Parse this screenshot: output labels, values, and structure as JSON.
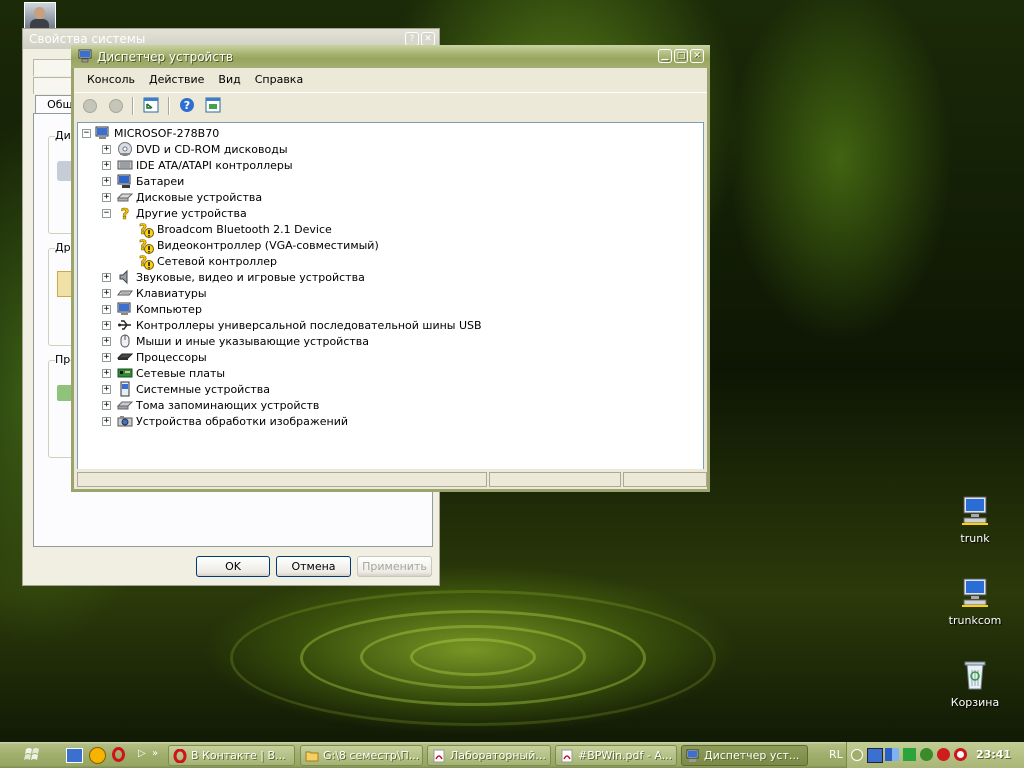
{
  "system_properties": {
    "title": "Свойства системы",
    "tab_general": "Общ",
    "group1_label": "Ди",
    "group2_label": "Др",
    "group3_label": "Пр",
    "ok_label": "OK",
    "cancel_label": "Отмена",
    "apply_label": "Применить"
  },
  "device_manager": {
    "title": "Диспетчер устройств",
    "menu": [
      "Консоль",
      "Действие",
      "Вид",
      "Справка"
    ],
    "root": "MICROSOF-278B70",
    "categories": [
      {
        "label": "DVD и CD-ROM дисководы",
        "icon": "cdrom-icon"
      },
      {
        "label": "IDE ATA/ATAPI контроллеры",
        "icon": "ide-controller-icon"
      },
      {
        "label": "Батареи",
        "icon": "battery-icon"
      },
      {
        "label": "Дисковые устройства",
        "icon": "disk-drive-icon"
      },
      {
        "label": "Другие устройства",
        "icon": "unknown-device-icon",
        "expanded": true,
        "children": [
          {
            "label": "Broadcom Bluetooth 2.1 Device",
            "icon": "warning-device-icon"
          },
          {
            "label": "Видеоконтроллер (VGA-совместимый)",
            "icon": "warning-device-icon"
          },
          {
            "label": "Сетевой контроллер",
            "icon": "warning-device-icon"
          }
        ]
      },
      {
        "label": "Звуковые, видео и игровые устройства",
        "icon": "speaker-icon"
      },
      {
        "label": "Клавиатуры",
        "icon": "keyboard-icon"
      },
      {
        "label": "Компьютер",
        "icon": "computer-icon"
      },
      {
        "label": "Контроллеры универсальной последовательной шины USB",
        "icon": "usb-icon"
      },
      {
        "label": "Мыши и иные указывающие устройства",
        "icon": "mouse-icon"
      },
      {
        "label": "Процессоры",
        "icon": "cpu-icon"
      },
      {
        "label": "Сетевые платы",
        "icon": "network-card-icon"
      },
      {
        "label": "Системные устройства",
        "icon": "system-device-icon"
      },
      {
        "label": "Тома запоминающих устройств",
        "icon": "storage-volume-icon"
      },
      {
        "label": "Устройства обработки изображений",
        "icon": "imaging-device-icon"
      }
    ]
  },
  "desktop_icons": [
    {
      "label": "trunk",
      "icon": "network-computer-icon"
    },
    {
      "label": "trunkcom",
      "icon": "network-computer-icon"
    },
    {
      "label": "Корзина",
      "icon": "recycle-bin-icon"
    }
  ],
  "taskbar": {
    "tasks": [
      {
        "label": "В Контакте | В...",
        "icon": "opera-icon"
      },
      {
        "label": "G:\\8 семестр\\П...",
        "icon": "folder-icon"
      },
      {
        "label": "Лабораторный...",
        "icon": "pdf-icon"
      },
      {
        "label": "#BPWin.pdf - A...",
        "icon": "pdf-icon"
      },
      {
        "label": "Диспетчер уст...",
        "icon": "device-manager-icon",
        "active": true
      }
    ],
    "language": "RL",
    "clock": "23:41"
  },
  "colors": {
    "title_active": "#9aa55f",
    "window_face": "#ece9d8",
    "warning_yellow": "#f7d117"
  }
}
